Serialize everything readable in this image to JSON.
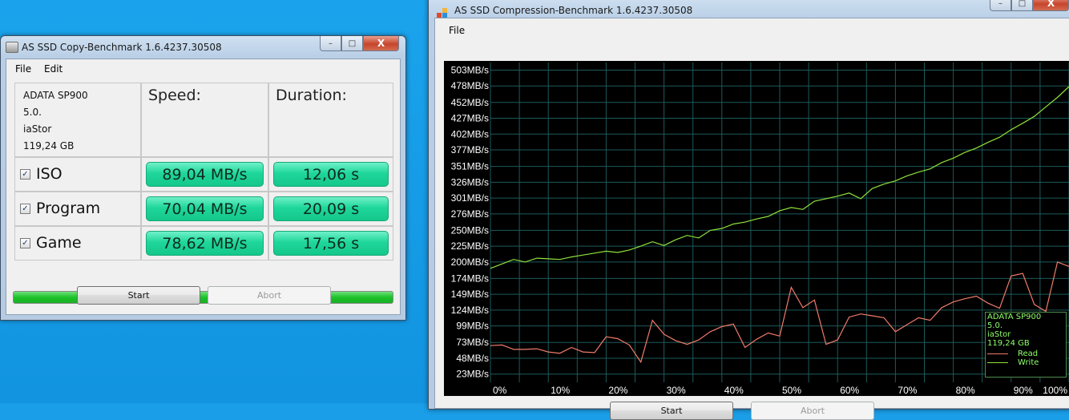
{
  "copy_window": {
    "title": "AS SSD Copy-Benchmark 1.6.4237.30508",
    "menu": [
      "File",
      "Edit"
    ],
    "drive": {
      "name": "ADATA SP900",
      "version": "5.0.",
      "driver": "iaStor",
      "size": "119,24 GB"
    },
    "headers": {
      "speed": "Speed:",
      "duration": "Duration:"
    },
    "rows": [
      {
        "label": "ISO",
        "checked": true,
        "speed": "89,04 MB/s",
        "duration": "12,06 s"
      },
      {
        "label": "Program",
        "checked": true,
        "speed": "70,04 MB/s",
        "duration": "20,09 s"
      },
      {
        "label": "Game",
        "checked": true,
        "speed": "78,62 MB/s",
        "duration": "17,56 s"
      }
    ],
    "progress": 1.0,
    "start_label": "Start",
    "abort_label": "Abort",
    "check_glyph": "✓",
    "close_glyph": "X",
    "min_glyph": "–",
    "max_glyph": "□"
  },
  "compression_window": {
    "title": "AS SSD Compression-Benchmark 1.6.4237.30508",
    "menu": [
      "File"
    ],
    "start_label": "Start",
    "abort_label": "Abort",
    "legend": {
      "lines": [
        "ADATA SP900",
        "5.0.",
        "iaStor",
        "119,24 GB"
      ],
      "read": "Read",
      "write": "Write"
    },
    "colors": {
      "read": "#8fe23a",
      "write": "#f07b6b",
      "grid": "#1d5a5a",
      "axis_text": "#ffffff"
    }
  },
  "chart_data": {
    "type": "line",
    "ylabel_ticks": [
      "503MB/s",
      "478MB/s",
      "452MB/s",
      "427MB/s",
      "402MB/s",
      "377MB/s",
      "351MB/s",
      "326MB/s",
      "301MB/s",
      "276MB/s",
      "250MB/s",
      "225MB/s",
      "200MB/s",
      "174MB/s",
      "149MB/s",
      "124MB/s",
      "99MB/s",
      "73MB/s",
      "48MB/s",
      "23MB/s"
    ],
    "y_tick_values": [
      503,
      478,
      452,
      427,
      402,
      377,
      351,
      326,
      301,
      276,
      250,
      225,
      200,
      174,
      149,
      124,
      99,
      73,
      48,
      23
    ],
    "xlabel_ticks": [
      "0%",
      "10%",
      "20%",
      "30%",
      "40%",
      "50%",
      "60%",
      "70%",
      "80%",
      "90%",
      "100%"
    ],
    "x_tick_values": [
      0,
      10,
      20,
      30,
      40,
      50,
      60,
      70,
      80,
      90,
      100
    ],
    "xlim": [
      0,
      100
    ],
    "ylim": [
      10,
      515
    ],
    "grid": true,
    "legend_position": "bottom-right",
    "series": [
      {
        "name": "Read",
        "color": "#8fe23a",
        "x": [
          0,
          2,
          4,
          6,
          8,
          10,
          12,
          14,
          16,
          18,
          20,
          22,
          24,
          26,
          28,
          30,
          32,
          34,
          36,
          38,
          40,
          42,
          44,
          46,
          48,
          50,
          52,
          54,
          56,
          58,
          60,
          62,
          64,
          66,
          68,
          70,
          72,
          74,
          76,
          78,
          80,
          82,
          84,
          86,
          88,
          90,
          92,
          94,
          96,
          98,
          100
        ],
        "y": [
          190,
          197,
          204,
          200,
          206,
          205,
          204,
          208,
          211,
          214,
          217,
          215,
          219,
          225,
          232,
          226,
          235,
          242,
          238,
          250,
          253,
          260,
          263,
          268,
          272,
          281,
          286,
          283,
          296,
          300,
          304,
          309,
          300,
          316,
          323,
          328,
          336,
          342,
          347,
          357,
          364,
          373,
          380,
          389,
          397,
          409,
          419,
          430,
          445,
          460,
          477
        ]
      },
      {
        "name": "Write",
        "color": "#f07b6b",
        "x": [
          0,
          2,
          4,
          6,
          8,
          10,
          12,
          14,
          16,
          18,
          20,
          22,
          24,
          26,
          28,
          30,
          32,
          34,
          36,
          38,
          40,
          42,
          44,
          46,
          48,
          50,
          52,
          54,
          56,
          58,
          60,
          62,
          64,
          66,
          68,
          70,
          72,
          74,
          76,
          78,
          80,
          82,
          84,
          86,
          88,
          90,
          92,
          94,
          96,
          98,
          100
        ],
        "y": [
          68,
          69,
          62,
          62,
          63,
          58,
          56,
          65,
          58,
          57,
          82,
          79,
          69,
          42,
          108,
          86,
          76,
          70,
          77,
          90,
          98,
          102,
          65,
          78,
          88,
          83,
          160,
          128,
          140,
          70,
          77,
          113,
          118,
          115,
          112,
          90,
          101,
          112,
          108,
          128,
          137,
          142,
          146,
          135,
          127,
          178,
          182,
          133,
          122,
          200,
          193
        ]
      }
    ]
  }
}
